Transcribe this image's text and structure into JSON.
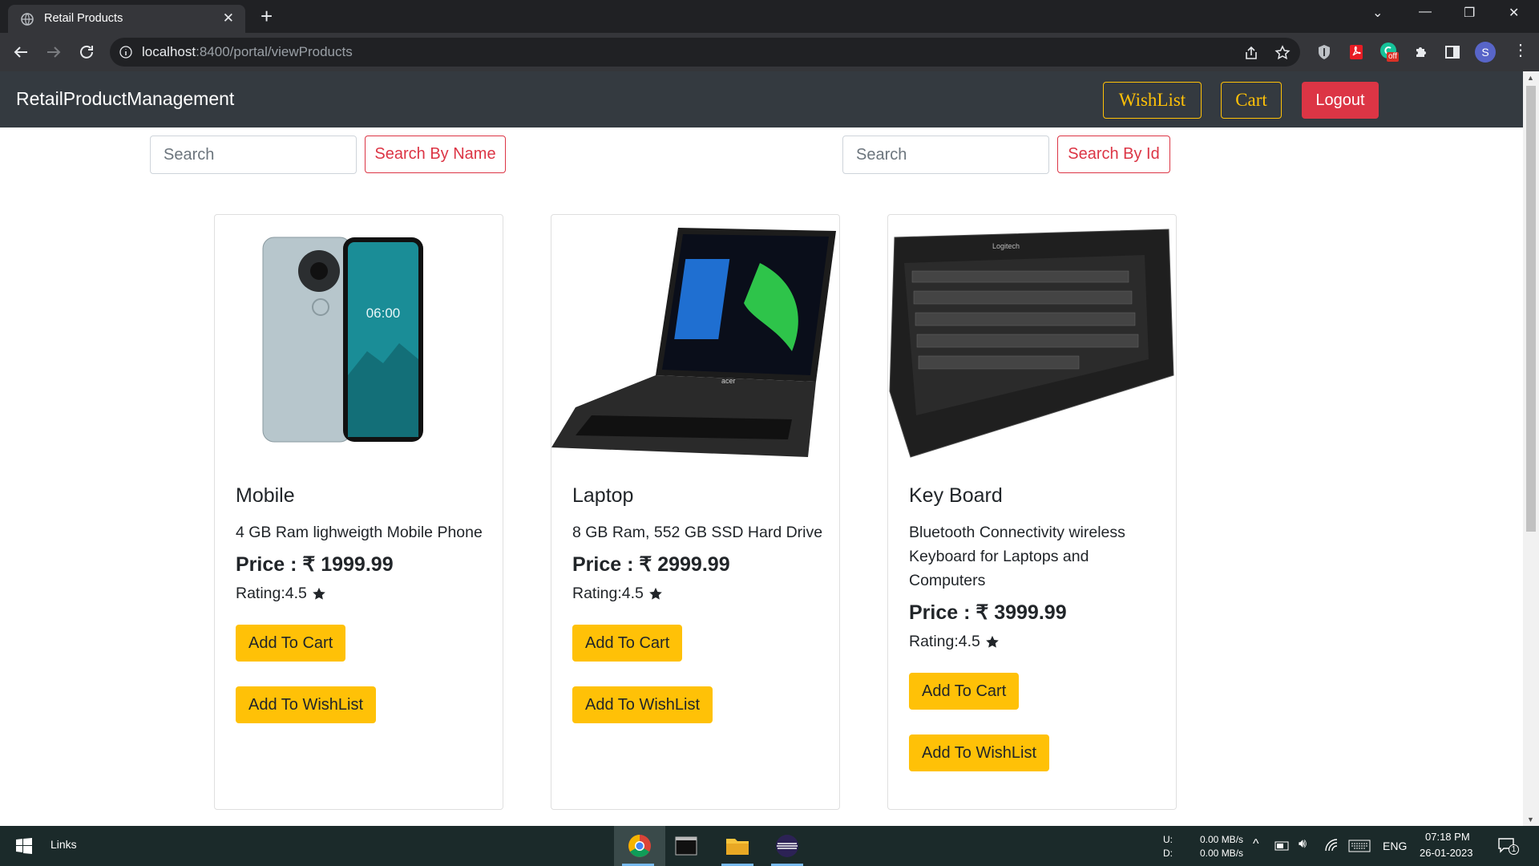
{
  "browser": {
    "tab_title": "Retail Products",
    "url_host": "localhost",
    "url_rest": ":8400/portal/viewProducts",
    "profile_initial": "S",
    "ext_badge": "off"
  },
  "navbar": {
    "brand": "RetailProductManagement",
    "wishlist_label": "WishList",
    "cart_label": "Cart",
    "logout_label": "Logout"
  },
  "search": {
    "name_placeholder": "Search",
    "name_button": "Search By Name",
    "id_placeholder": "Search",
    "id_button": "Search By Id"
  },
  "products": [
    {
      "name": "Mobile",
      "description": "4 GB Ram lighweigth Mobile Phone",
      "price": "Price : ₹ 1999.99",
      "rating": "Rating:4.5",
      "cart_label": "Add To Cart",
      "wishlist_label": "Add To WishList",
      "screen_time": "06:00"
    },
    {
      "name": "Laptop",
      "description": "8 GB Ram, 552 GB SSD Hard Drive",
      "price": "Price : ₹ 2999.99",
      "rating": "Rating:4.5",
      "cart_label": "Add To Cart",
      "wishlist_label": "Add To WishList",
      "brand_text": "acer"
    },
    {
      "name": "Key Board",
      "description": "Bluetooth Connectivity wireless Keyboard for Laptops and Computers",
      "price": "Price : ₹ 3999.99",
      "rating": "Rating:4.5",
      "cart_label": "Add To Cart",
      "wishlist_label": "Add To WishList",
      "brand_text": "Logitech"
    }
  ],
  "taskbar": {
    "links_label": "Links",
    "net_up_label": "U:",
    "net_down_label": "D:",
    "net_up": "0.00 MB/s",
    "net_down": "0.00 MB/s",
    "lang": "ENG",
    "time": "07:18 PM",
    "date": "26-01-2023",
    "notif_count": "1"
  },
  "colors": {
    "navbar_bg": "#343a40",
    "warning": "#ffc107",
    "danger": "#dc3545"
  }
}
